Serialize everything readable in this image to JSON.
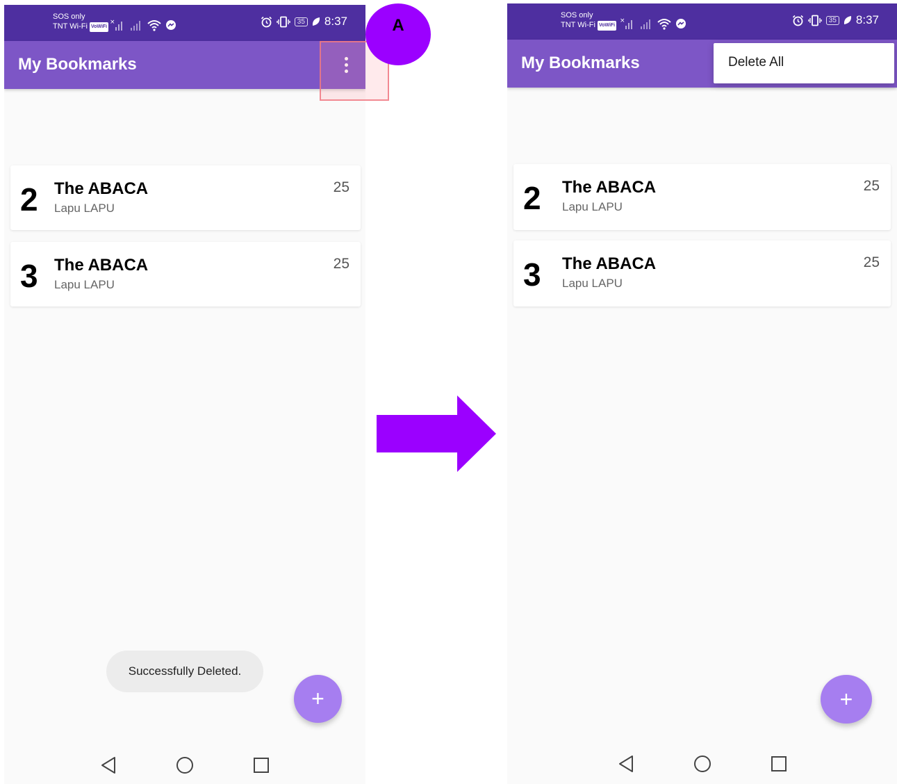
{
  "status_bar": {
    "carrier_line1": "SOS only",
    "carrier_line2": "TNT Wi-Fi",
    "vowifi_badge": "VoWiFi",
    "battery_level": "35",
    "time": "8:37",
    "icons": [
      "signal-x-icon",
      "signal-icon",
      "wifi-icon",
      "messenger-icon",
      "alarm-icon",
      "vibrate-icon",
      "battery-icon",
      "leaf-icon"
    ],
    "color": "#4e2fa0"
  },
  "app_bar": {
    "title": "My Bookmarks",
    "overflow_icon": "more-vert-icon",
    "color": "#7d56c6"
  },
  "bookmarks": [
    {
      "number": "2",
      "title": "The ABACA",
      "subtitle": "Lapu LAPU",
      "count": "25"
    },
    {
      "number": "3",
      "title": "The ABACA",
      "subtitle": "Lapu LAPU",
      "count": "25"
    }
  ],
  "toast": {
    "message": "Successfully Deleted."
  },
  "fab": {
    "label": "+",
    "color": "#a67ef0"
  },
  "overflow_menu": {
    "items": [
      {
        "label": "Delete All"
      }
    ]
  },
  "nav_bar": {
    "icons": [
      "back-icon",
      "home-icon",
      "recents-icon"
    ]
  },
  "annotation": {
    "marker_label": "A",
    "marker_color": "#9b00ff"
  }
}
